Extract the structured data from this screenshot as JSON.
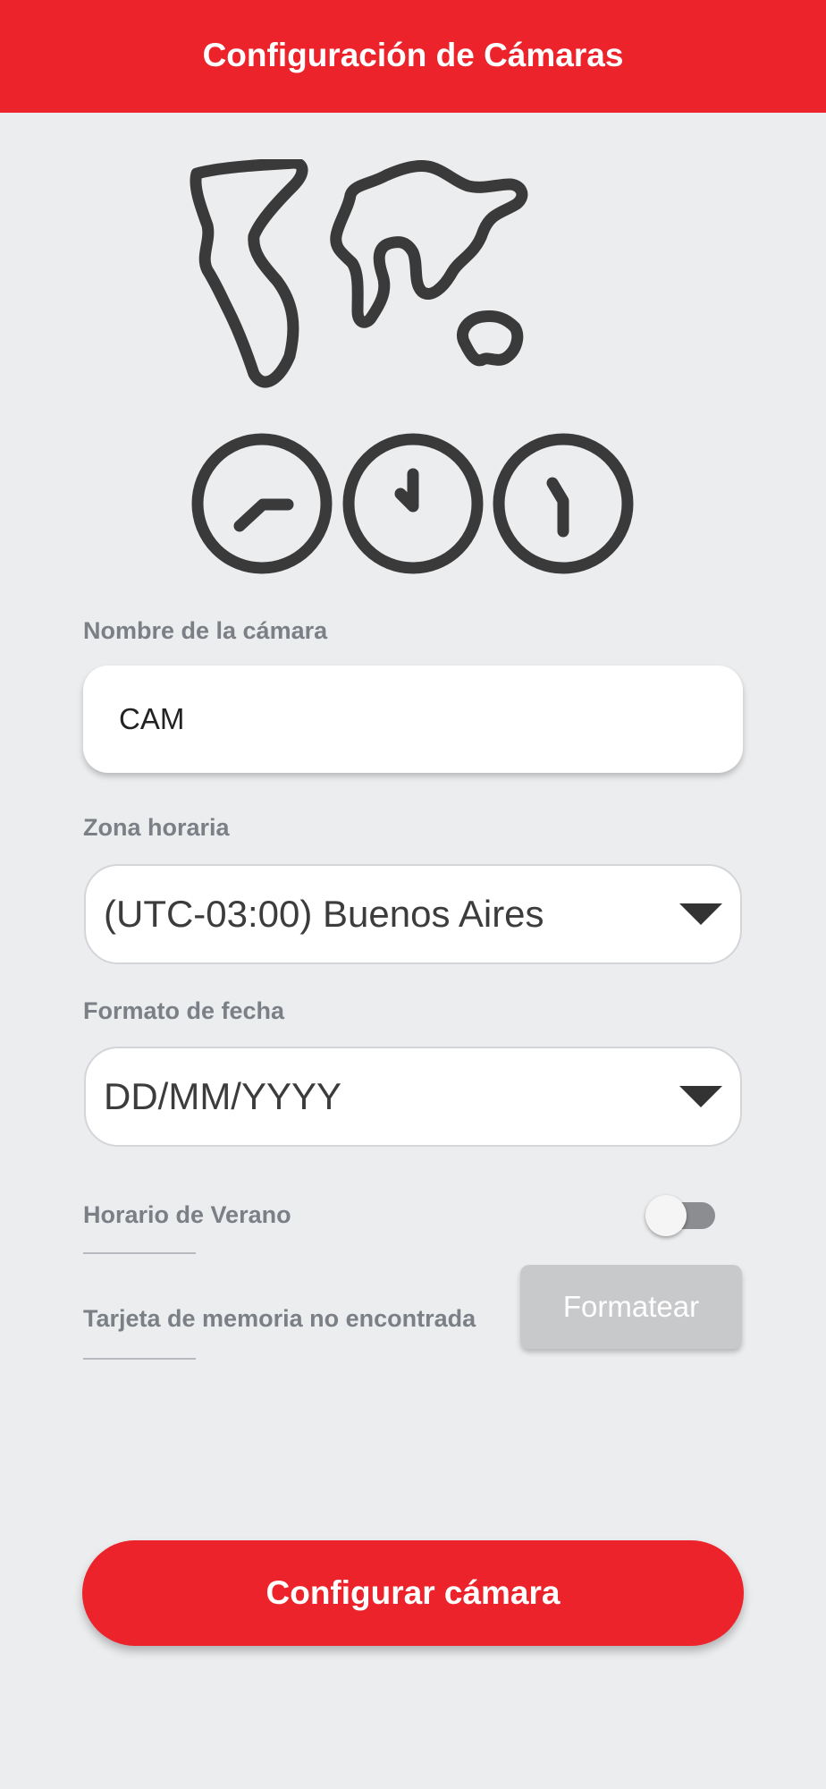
{
  "header": {
    "title": "Configuración de Cámaras"
  },
  "hero": {
    "icon": "world-map-clocks-icon"
  },
  "form": {
    "camera_name": {
      "label": "Nombre de la cámara",
      "value": "CAM"
    },
    "timezone": {
      "label": "Zona horaria",
      "selected": "(UTC-03:00) Buenos Aires"
    },
    "date_format": {
      "label": "Formato de fecha",
      "selected": "DD/MM/YYYY"
    },
    "daylight_saving": {
      "label": "Horario de Verano",
      "enabled": false
    },
    "memory_card": {
      "status": "Tarjeta de memoria no encontrada",
      "button_label": "Formatear"
    }
  },
  "actions": {
    "configure_label": "Configurar cámara"
  },
  "colors": {
    "brand": "#EC232A",
    "background": "#ECEDEF",
    "label": "#7B8086",
    "icon": "#3A3A3A"
  }
}
